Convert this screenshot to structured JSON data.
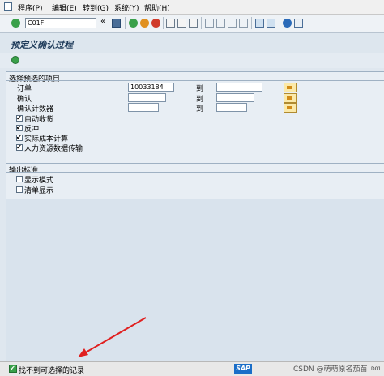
{
  "menu": {
    "items": [
      "程序(P)",
      "编辑(E)",
      "转到(G)",
      "系统(Y)",
      "帮助(H)"
    ]
  },
  "toolbar": {
    "command_value": "C01F",
    "dropdown_glyph": "▼",
    "back_glyph": "«"
  },
  "screen": {
    "title": "预定义确认过程"
  },
  "selection": {
    "group_title": "选择预选的项目",
    "rows": [
      {
        "label": "订单",
        "from_value": "10033184",
        "to_label": "到"
      },
      {
        "label": "确认",
        "from_value": "",
        "to_label": "到"
      },
      {
        "label": "确认计数器",
        "from_value": "",
        "to_label": "到"
      }
    ],
    "checkboxes": [
      {
        "label": "自动收货",
        "checked": true
      },
      {
        "label": "反冲",
        "checked": true
      },
      {
        "label": "实际成本计算",
        "checked": true
      },
      {
        "label": "人力资源数据传输",
        "checked": true
      }
    ]
  },
  "output": {
    "group_title": "输出标准",
    "checkboxes": [
      {
        "label": "显示模式",
        "checked": false
      },
      {
        "label": "清单显示",
        "checked": false
      }
    ]
  },
  "status": {
    "message": "找不到可选择的记录",
    "sap_logo_text": "SAP",
    "watermark": "CSDN @萌萌原名茄苗",
    "system_code": "D01"
  },
  "colors": {
    "accent": "#1e3b5a",
    "arrow": "#e02020",
    "success": "#3aa04a"
  }
}
